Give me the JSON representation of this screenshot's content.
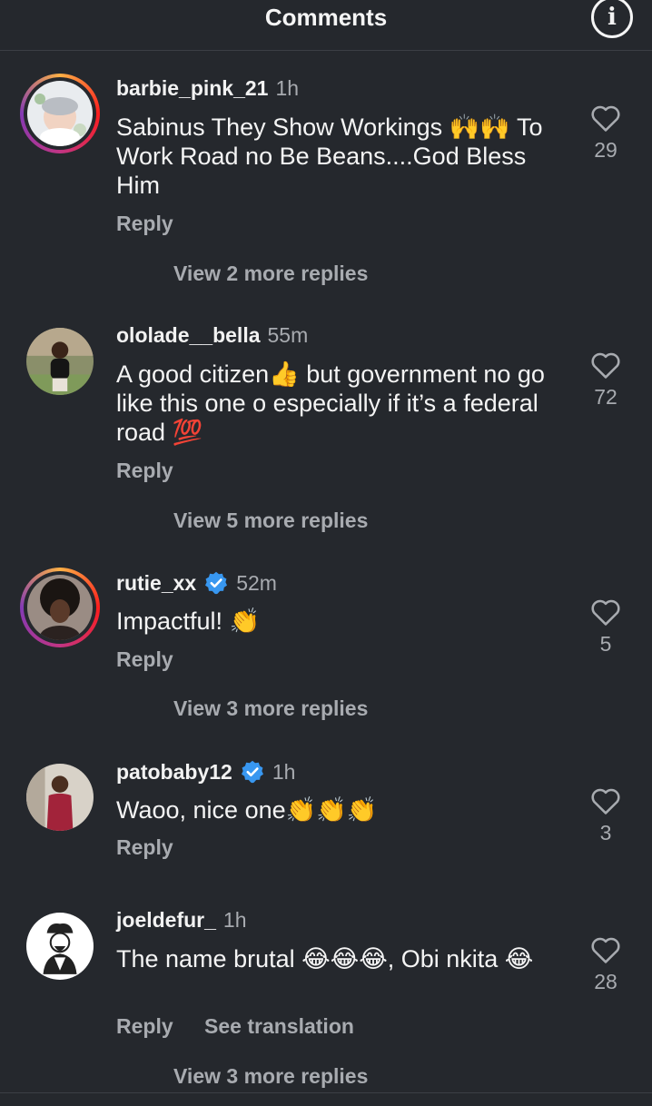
{
  "header": {
    "title": "Comments",
    "info_icon": "info-icon"
  },
  "comments": [
    {
      "username": "barbie_pink_21",
      "time": "1h",
      "verified": false,
      "text": "Sabinus They Show Workings 🙌🙌 To Work Road no Be Beans....God Bless Him",
      "likes": "29",
      "reply_label": "Reply",
      "view_replies": "View 2 more replies",
      "has_story_ring": true
    },
    {
      "username": "ololade__bella",
      "time": "55m",
      "verified": false,
      "text": "A good citizen👍 but government no go like this one o especially if it’s a federal road 💯",
      "likes": "72",
      "reply_label": "Reply",
      "view_replies": "View 5 more replies",
      "has_story_ring": false
    },
    {
      "username": "rutie_xx",
      "time": "52m",
      "verified": true,
      "text": "Impactful! 👏",
      "likes": "5",
      "reply_label": "Reply",
      "view_replies": "View 3 more replies",
      "has_story_ring": true
    },
    {
      "username": "patobaby12",
      "time": "1h",
      "verified": true,
      "text": "Waoo, nice one👏👏👏",
      "likes": "3",
      "reply_label": "Reply",
      "has_story_ring": false
    },
    {
      "username": "joeldefur_",
      "time": "1h",
      "verified": false,
      "text": "The name brutal 😂😂😂, Obi nkita 😂",
      "likes": "28",
      "reply_label": "Reply",
      "translate_label": "See translation",
      "view_replies": "View 3 more replies",
      "has_story_ring": false
    }
  ],
  "colors": {
    "background": "#25282d",
    "muted_text": "#a8abb0",
    "verified_blue": "#3897f0"
  }
}
